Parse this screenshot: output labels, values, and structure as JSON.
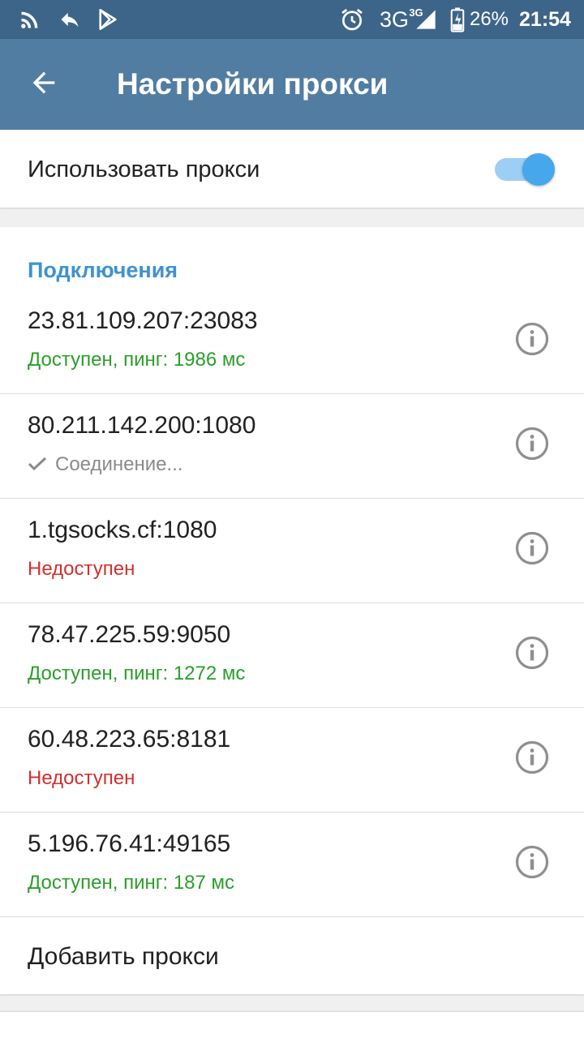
{
  "status_bar": {
    "network": "3G",
    "network_small": "3G",
    "battery": "26%",
    "time": "21:54",
    "icons": [
      "rss-icon",
      "reply-icon",
      "play-store-icon",
      "alarm-icon",
      "signal-icon",
      "battery-charging-icon"
    ]
  },
  "app_bar": {
    "title": "Настройки прокси",
    "back_icon": "arrow-back-icon"
  },
  "use_proxy": {
    "label": "Использовать прокси",
    "enabled": true
  },
  "connections": {
    "header": "Подключения",
    "items": [
      {
        "address": "23.81.109.207:23083",
        "status": "Доступен, пинг: 1986 мс",
        "state": "ok"
      },
      {
        "address": "80.211.142.200:1080",
        "status": "Соединение...",
        "state": "connecting"
      },
      {
        "address": "1.tgsocks.cf:1080",
        "status": "Недоступен",
        "state": "unavailable"
      },
      {
        "address": "78.47.225.59:9050",
        "status": "Доступен, пинг: 1272 мс",
        "state": "ok"
      },
      {
        "address": "60.48.223.65:8181",
        "status": "Недоступен",
        "state": "unavailable"
      },
      {
        "address": "5.196.76.41:49165",
        "status": "Доступен, пинг: 187 мс",
        "state": "ok"
      }
    ],
    "add_label": "Добавить прокси"
  },
  "colors": {
    "status_bar": "#3d6589",
    "app_bar": "#527da3",
    "accent": "#3f92cf",
    "ok": "#2a9e2a",
    "error": "#d32f2f",
    "toggle_thumb": "#46a7ec",
    "toggle_track": "#9ccff3"
  }
}
